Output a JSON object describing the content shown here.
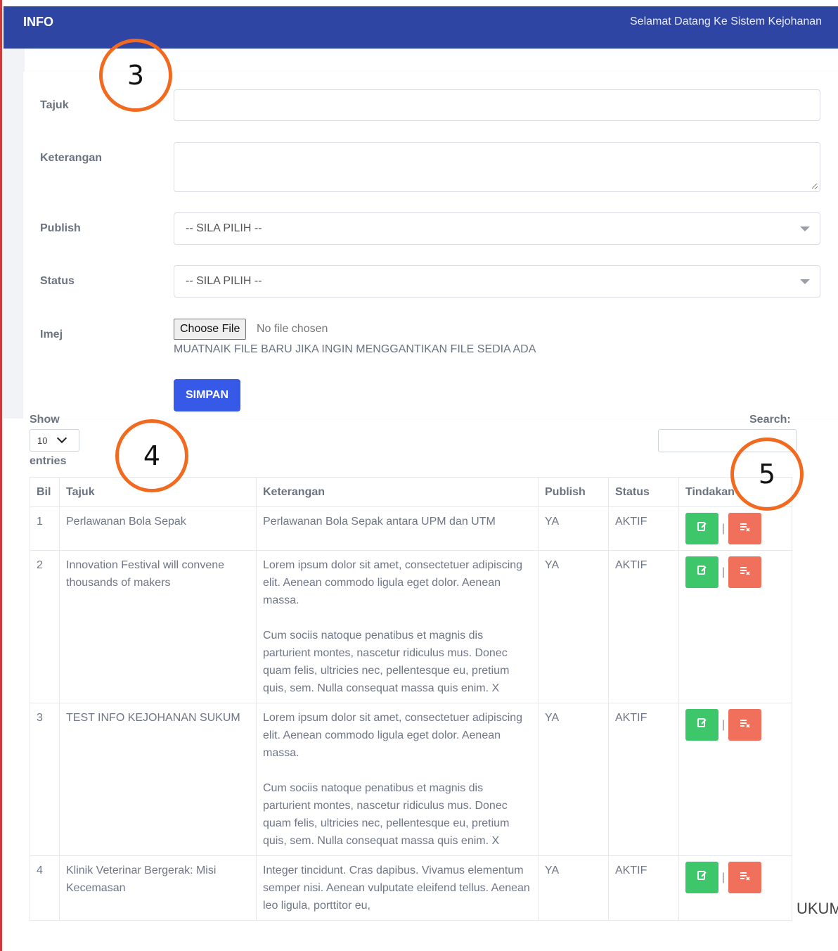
{
  "header": {
    "title": "INFO",
    "welcome": "Selamat Datang Ke Sistem Kejohanan"
  },
  "form": {
    "tajuk_label": "Tajuk",
    "tajuk_value": "",
    "keterangan_label": "Keterangan",
    "keterangan_value": "",
    "publish_label": "Publish",
    "publish_value": "-- SILA PILIH --",
    "status_label": "Status",
    "status_value": "-- SILA PILIH --",
    "imej_label": "Imej",
    "choose_file": "Choose File",
    "no_file": "No file chosen",
    "hint": "MUATNAIK FILE BARU JIKA INGIN MENGGANTIKAN FILE SEDIA ADA",
    "save": "SIMPAN"
  },
  "table_controls": {
    "show": "Show",
    "length_value": "10",
    "entries": "entries",
    "search_label": "Search:",
    "search_value": ""
  },
  "table": {
    "headers": [
      "Bil",
      "Tajuk",
      "Keterangan",
      "Publish",
      "Status",
      "Tindakan"
    ],
    "separator": "|",
    "rows": [
      {
        "bil": "1",
        "tajuk": "Perlawanan Bola Sepak",
        "keterangan": "Perlawanan Bola Sepak antara UPM dan UTM",
        "publish": "YA",
        "status": "AKTIF"
      },
      {
        "bil": "2",
        "tajuk": "Innovation Festival will convene thousands of makers",
        "keterangan": "Lorem ipsum dolor sit amet, consectetuer adipiscing elit. Aenean commodo ligula eget dolor. Aenean massa.\n\nCum sociis natoque penatibus et magnis dis parturient montes, nascetur ridiculus mus. Donec quam felis, ultricies nec, pellentesque eu, pretium quis, sem. Nulla consequat massa quis enim. X",
        "publish": "YA",
        "status": "AKTIF"
      },
      {
        "bil": "3",
        "tajuk": "TEST INFO KEJOHANAN SUKUM",
        "keterangan": "Lorem ipsum dolor sit amet, consectetuer adipiscing elit. Aenean commodo ligula eget dolor. Aenean massa.\n\nCum sociis natoque penatibus et magnis dis parturient montes, nascetur ridiculus mus. Donec quam felis, ultricies nec, pellentesque eu, pretium quis, sem. Nulla consequat massa quis enim. X",
        "publish": "YA",
        "status": "AKTIF"
      },
      {
        "bil": "4",
        "tajuk": "Klinik Veterinar Bergerak: Misi Kecemasan",
        "keterangan": "Integer tincidunt. Cras dapibus. Vivamus elementum semper nisi. Aenean vulputate eleifend tellus. Aenean leo ligula, porttitor eu,",
        "publish": "YA",
        "status": "AKTIF"
      }
    ]
  },
  "footer_fragment": "UKUM",
  "annotations": [
    "3",
    "4",
    "5"
  ],
  "colors": {
    "header_bg": "#2e45a4",
    "save_button": "#3759e8",
    "edit_button": "#3ec66a",
    "delete_button": "#f1705c",
    "annotation_ring": "#f26a1f"
  },
  "icons": {
    "edit": "edit-icon",
    "delete": "delete-icon"
  }
}
